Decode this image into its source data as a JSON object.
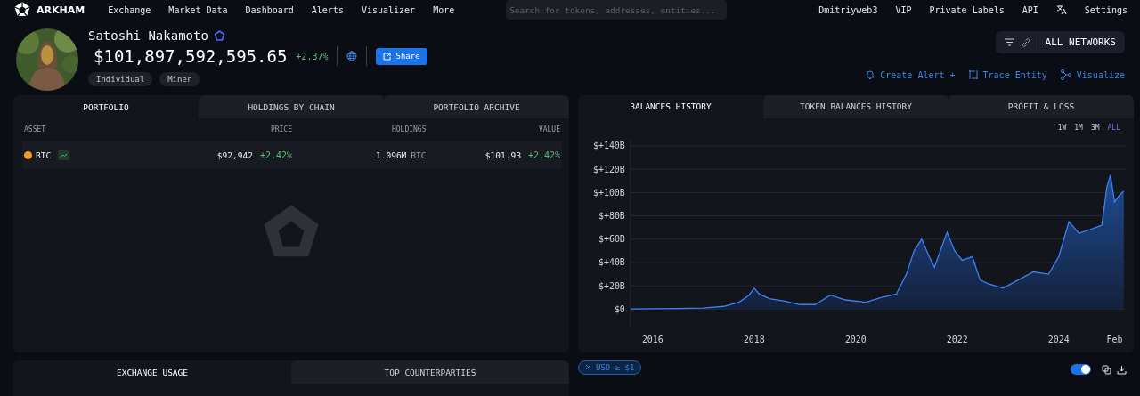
{
  "nav": {
    "brand": "ARKHAM",
    "links": [
      "Exchange",
      "Market Data",
      "Dashboard",
      "Alerts",
      "Visualizer",
      "More"
    ],
    "search": {
      "placeholder": "Search for tokens, addresses, entities..."
    },
    "user_links": [
      "Dmitriyweb3",
      "VIP",
      "Private Labels",
      "API"
    ],
    "settings": "Settings"
  },
  "profile": {
    "name": "Satoshi Nakamoto",
    "verified": true,
    "balance": "$101,897,592,595.65",
    "change": "+2.37%",
    "share": "Share",
    "tags": [
      "Individual",
      "Miner"
    ]
  },
  "network_filter": {
    "label": "ALL NETWORKS"
  },
  "actions": [
    {
      "kind": "alert",
      "label": "Create Alert +"
    },
    {
      "kind": "trace",
      "label": "Trace Entity"
    },
    {
      "kind": "visualize",
      "label": "Visualize"
    }
  ],
  "portfolio": {
    "tabs": [
      {
        "label": "PORTFOLIO",
        "selected": true
      },
      {
        "label": "HOLDINGS BY CHAIN",
        "selected": false
      },
      {
        "label": "PORTFOLIO ARCHIVE",
        "selected": false
      }
    ],
    "columns": [
      "ASSET",
      "PRICE",
      "HOLDINGS",
      "VALUE"
    ],
    "rows": [
      {
        "asset": "BTC",
        "price": "$92,942",
        "price_change": "+2.42%",
        "holdings": "1.096M",
        "holdings_unit": "BTC",
        "value": "$101.9B",
        "value_change": "+2.42%"
      }
    ]
  },
  "history": {
    "tabs": [
      {
        "label": "BALANCES HISTORY",
        "selected": true
      },
      {
        "label": "TOKEN BALANCES HISTORY",
        "selected": false
      },
      {
        "label": "PROFIT & LOSS",
        "selected": false
      }
    ],
    "ranges": [
      {
        "label": "1W",
        "selected": false
      },
      {
        "label": "1M",
        "selected": false
      },
      {
        "label": "3M",
        "selected": false
      },
      {
        "label": "ALL",
        "selected": true
      }
    ],
    "chart_data": {
      "type": "area",
      "grid": true,
      "xlim": [
        2015.56,
        2025.3
      ],
      "ylim": [
        -16,
        146
      ],
      "xticks": [
        {
          "value": 2016,
          "label": "2016"
        },
        {
          "value": 2018,
          "label": "2018"
        },
        {
          "value": 2020,
          "label": "2020"
        },
        {
          "value": 2022,
          "label": "2022"
        },
        {
          "value": 2024,
          "label": "2024"
        },
        {
          "value": 2025.1,
          "label": "Feb"
        }
      ],
      "yticks": [
        {
          "value": 0,
          "label": "$0"
        },
        {
          "value": 20,
          "label": "$+20B"
        },
        {
          "value": 40,
          "label": "$+40B"
        },
        {
          "value": 60,
          "label": "$+60B"
        },
        {
          "value": 80,
          "label": "$+80B"
        },
        {
          "value": 100,
          "label": "$+100B"
        },
        {
          "value": 120,
          "label": "$+120B"
        },
        {
          "value": 140,
          "label": "$+140B"
        }
      ],
      "x": [
        2015.56,
        2016,
        2016.5,
        2017,
        2017.4,
        2017.7,
        2017.9,
        2018,
        2018.1,
        2018.3,
        2018.6,
        2018.9,
        2019.2,
        2019.5,
        2019.8,
        2020.2,
        2020.5,
        2020.8,
        2021,
        2021.15,
        2021.3,
        2021.45,
        2021.55,
        2021.8,
        2021.95,
        2022.1,
        2022.3,
        2022.45,
        2022.6,
        2022.9,
        2023.2,
        2023.5,
        2023.8,
        2024,
        2024.2,
        2024.4,
        2024.6,
        2024.85,
        2024.95,
        2025.02,
        2025.1,
        2025.2,
        2025.28
      ],
      "series": [
        {
          "color": "#3b82f6",
          "values": [
            0.3,
            0.5,
            0.7,
            1,
            2.5,
            6,
            12,
            18,
            13,
            9,
            7,
            4,
            4,
            12,
            8,
            6,
            10,
            13,
            30,
            50,
            60,
            45,
            36,
            66,
            50,
            42,
            45,
            25,
            22,
            18,
            25,
            32,
            30,
            45,
            75,
            65,
            68,
            72,
            105,
            115,
            92,
            98,
            101
          ]
        }
      ]
    }
  },
  "filter_chip": {
    "label": "USD ≥ $1"
  },
  "toggle": {
    "on": true
  },
  "bottom_tabs": [
    {
      "label": "EXCHANGE USAGE",
      "selected": true
    },
    {
      "label": "TOP COUNTERPARTIES",
      "selected": false
    }
  ]
}
